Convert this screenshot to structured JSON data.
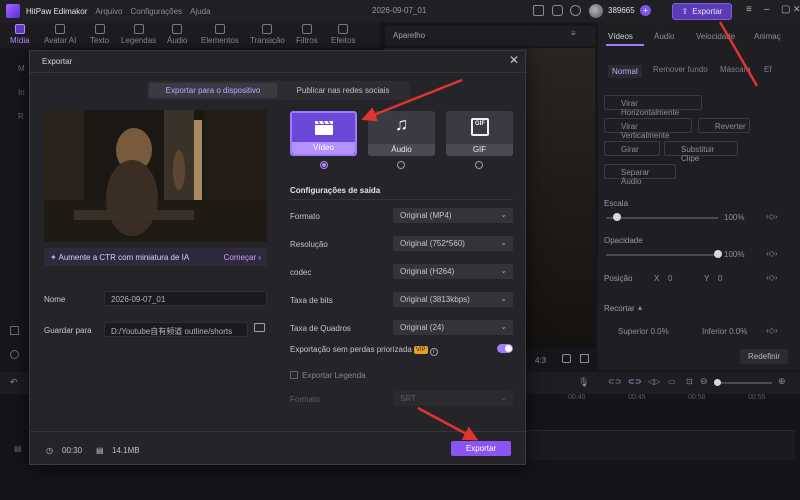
{
  "titlebar": {
    "app_name": "HitPaw Edimakor",
    "menus": [
      "Arquivo",
      "Configurações",
      "Ajuda"
    ],
    "project_name": "2026-09-07_01",
    "coins": "389665",
    "export_label": "Exportar"
  },
  "toolbar": {
    "items": [
      "Mídia",
      "Avatar AI",
      "Texto",
      "Legendas",
      "Áudio",
      "Elementos",
      "Transição",
      "Filtros",
      "Efeitos"
    ]
  },
  "preview": {
    "label": "Aparelho",
    "ratio": "4:3"
  },
  "right_panel": {
    "tabs": [
      "Vídeos",
      "Áudio",
      "Velocidade",
      "Animaç"
    ],
    "subtabs": [
      "Normal",
      "Remover fundo",
      "Máscara",
      "Ef"
    ],
    "buttons": [
      "Virar Horizontalmente",
      "Virar Verticalmente",
      "Reverter",
      "Girar",
      "Substituir Clipe",
      "Separar Áudio"
    ],
    "scale_label": "Escala",
    "scale_value": "100%",
    "scale_level": 0.1,
    "opacity_label": "Opacidade",
    "opacity_value": "100%",
    "opacity_level": 1.0,
    "position_label": "Posição",
    "pos_x_label": "X",
    "pos_x": "0",
    "pos_y_label": "Y",
    "pos_y": "0",
    "crop_label": "Recortar",
    "crop_top": "Superior 0.0%",
    "crop_bottom": "Inferior 0.0%",
    "reset_label": "Redefinir"
  },
  "modal": {
    "title": "Exportar",
    "tab_device": "Exportar para o dispositivo",
    "tab_social": "Publicar nas redes sociais",
    "ctr_text": "Aumente a CTR com miniatura de IA",
    "ctr_action": "Começar",
    "name_label": "Nome",
    "name_value": "2026-09-07_01",
    "save_label": "Guardar para",
    "save_value": "D:/Youtube自有频道 outline/shorts",
    "formats": [
      "Vídeo",
      "Áudio",
      "GIF"
    ],
    "config_title": "Configurações de saída",
    "settings": [
      {
        "label": "Formato",
        "value": "Original (MP4)"
      },
      {
        "label": "Resolução",
        "value": "Original (752*560)"
      },
      {
        "label": "codec",
        "value": "Original (H264)"
      },
      {
        "label": "Taxa de bits",
        "value": "Original (3813kbps)"
      },
      {
        "label": "Taxa de Quadros",
        "value": "Original (24)"
      }
    ],
    "lossless_label": "Exportação sem perdas priorizada",
    "vip_badge": "VIP",
    "subtitle_label": "Exportar Legenda",
    "subtitle_format_label": "Formato",
    "subtitle_format_value": "SRT",
    "duration": "00:30",
    "size": "14.1MB",
    "export_label": "Exportar"
  },
  "timeline": {
    "marks": [
      "00:40",
      "00:45",
      "00:50",
      "00:55"
    ]
  },
  "colors": {
    "accent": "#8a55f0",
    "arrow": "#e0342f"
  }
}
